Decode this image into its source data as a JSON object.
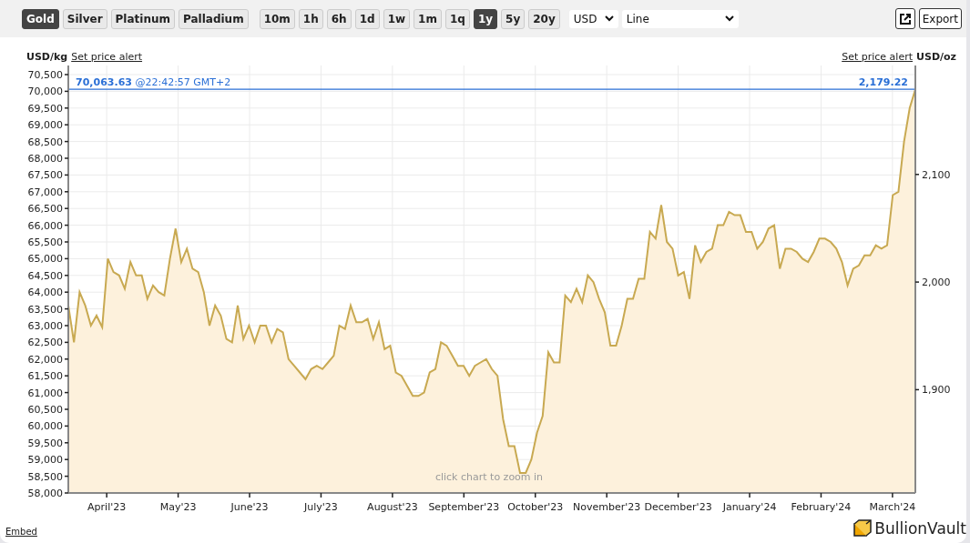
{
  "toolbar": {
    "metals": [
      {
        "label": "Gold",
        "selected": true
      },
      {
        "label": "Silver",
        "selected": false
      },
      {
        "label": "Platinum",
        "selected": false
      },
      {
        "label": "Palladium",
        "selected": false
      }
    ],
    "ranges": [
      {
        "label": "10m",
        "selected": false
      },
      {
        "label": "1h",
        "selected": false
      },
      {
        "label": "6h",
        "selected": false
      },
      {
        "label": "1d",
        "selected": false
      },
      {
        "label": "1w",
        "selected": false
      },
      {
        "label": "1m",
        "selected": false
      },
      {
        "label": "1q",
        "selected": false
      },
      {
        "label": "1y",
        "selected": true
      },
      {
        "label": "5y",
        "selected": false
      },
      {
        "label": "20y",
        "selected": false
      }
    ],
    "currency": "USD",
    "chart_type": "Line",
    "export_label": "Export"
  },
  "header": {
    "left_link": "Set price alert",
    "right_link": "Set price alert",
    "right_unit": "USD/oz"
  },
  "current_price": {
    "kg": "70,063.63",
    "time": "@22:42:57 GMT+2",
    "oz": "2,179.22"
  },
  "chart": {
    "hint": "click chart to zoom in",
    "right_ticks": [
      "2,100",
      "2,000",
      "1,900"
    ],
    "month_labels": [
      "April'23",
      "May'23",
      "June'23",
      "July'23",
      "August'23",
      "September'23",
      "October'23",
      "November'23",
      "December'23",
      "January'24",
      "February'24",
      "March'24"
    ],
    "chart_data": {
      "type": "area",
      "ylabel": "USD/kg",
      "ylim": [
        58000,
        70500
      ],
      "yticks": [
        {
          "value": 58000,
          "label": "58,000"
        },
        {
          "value": 58500,
          "label": "58,500"
        },
        {
          "value": 59000,
          "label": "59,000"
        },
        {
          "value": 59500,
          "label": "59,500"
        },
        {
          "value": 60000,
          "label": "60,000"
        },
        {
          "value": 60500,
          "label": "60,500"
        },
        {
          "value": 61000,
          "label": "61,000"
        },
        {
          "value": 61500,
          "label": "61,500"
        },
        {
          "value": 62000,
          "label": "62,000"
        },
        {
          "value": 62500,
          "label": "62,500"
        },
        {
          "value": 63000,
          "label": "63,000"
        },
        {
          "value": 63500,
          "label": "63,500"
        },
        {
          "value": 64000,
          "label": "64,000"
        },
        {
          "value": 64500,
          "label": "64,500"
        },
        {
          "value": 65000,
          "label": "65,000"
        },
        {
          "value": 65500,
          "label": "65,500"
        },
        {
          "value": 66000,
          "label": "66,000"
        },
        {
          "value": 66500,
          "label": "66,500"
        },
        {
          "value": 67000,
          "label": "67,000"
        },
        {
          "value": 67500,
          "label": "67,500"
        },
        {
          "value": 68000,
          "label": "68,000"
        },
        {
          "value": 68500,
          "label": "68,500"
        },
        {
          "value": 69000,
          "label": "69,000"
        },
        {
          "value": 69500,
          "label": "69,500"
        },
        {
          "value": 70000,
          "label": "70,000"
        },
        {
          "value": 70500,
          "label": "70,500"
        }
      ],
      "grid": true,
      "ref_lines": [
        {
          "axis": "y",
          "value": 70060,
          "color": "#2a6fd6"
        }
      ],
      "series": [
        {
          "color": "#c8a951",
          "values": [
            63600,
            62500,
            64000,
            63600,
            63000,
            63300,
            62950,
            65000,
            64600,
            64500,
            64100,
            64900,
            64500,
            64500,
            63800,
            64200,
            64000,
            63900,
            65000,
            65900,
            64900,
            65300,
            64700,
            64600,
            64000,
            63000,
            63600,
            63300,
            62600,
            62500,
            63600,
            62600,
            63000,
            62500,
            63000,
            63000,
            62500,
            62900,
            62800,
            62000,
            61800,
            61600,
            61400,
            61700,
            61800,
            61700,
            61900,
            62100,
            63000,
            62900,
            63600,
            63100,
            63100,
            63200,
            62600,
            63100,
            62300,
            62400,
            61600,
            61500,
            61200,
            60900,
            60900,
            61000,
            61600,
            61700,
            62500,
            62400,
            62100,
            61800,
            61800,
            61500,
            61800,
            61900,
            62000,
            61700,
            61500,
            60200,
            59400,
            59400,
            58600,
            58600,
            59000,
            59800,
            60300,
            62200,
            61900,
            61900,
            63900,
            63700,
            64100,
            63700,
            64500,
            64300,
            63800,
            63400,
            62400,
            62400,
            63000,
            63800,
            63800,
            64400,
            64400,
            65800,
            65600,
            66600,
            65500,
            65300,
            64500,
            64600,
            63800,
            65400,
            64900,
            65200,
            65300,
            66000,
            66000,
            66400,
            66300,
            66300,
            65800,
            65800,
            65300,
            65500,
            65900,
            66000,
            64700,
            65300,
            65300,
            65200,
            65000,
            64900,
            65200,
            65600,
            65600,
            65500,
            65300,
            64900,
            64200,
            64700,
            64800,
            65100,
            65100,
            65400,
            65300,
            65400,
            66900,
            67000,
            68500,
            69500,
            70060
          ]
        }
      ]
    }
  },
  "footer": {
    "embed": "Embed",
    "logo": "BullionVault"
  }
}
